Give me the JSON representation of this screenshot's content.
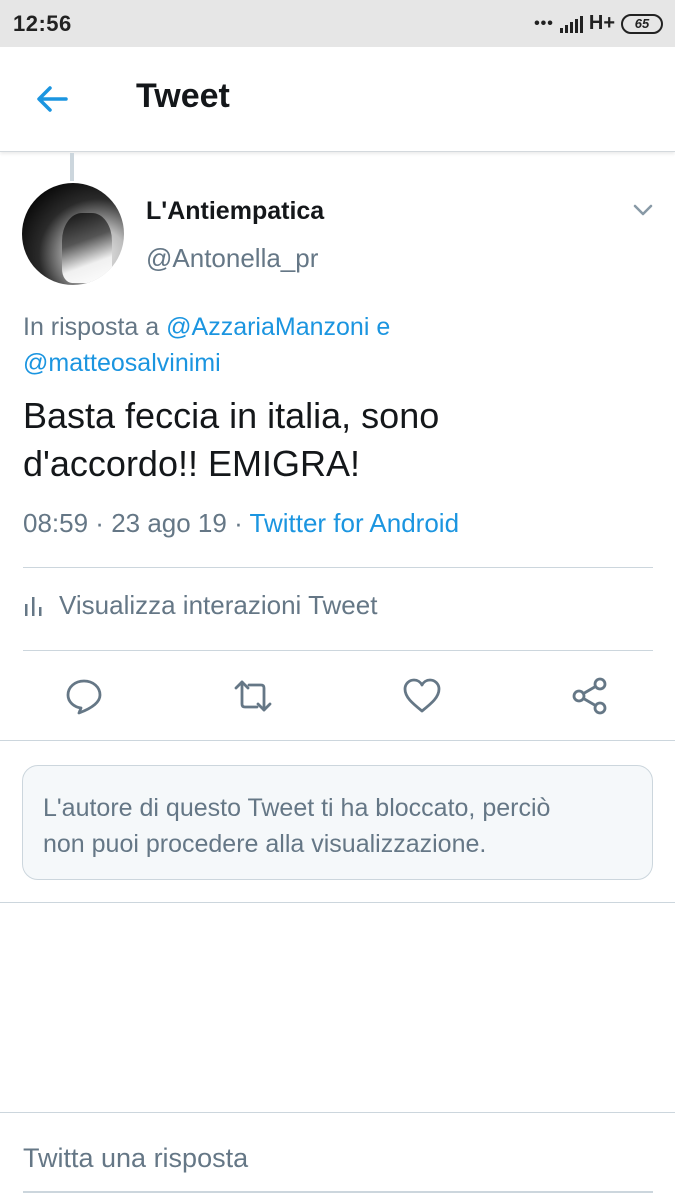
{
  "status_bar": {
    "time": "12:56",
    "dots": "•••",
    "network": "H+",
    "battery": "65"
  },
  "app_bar": {
    "title": "Tweet",
    "back_icon": "arrow-left-icon"
  },
  "tweet": {
    "author": {
      "display_name": "L'Antiempatica",
      "handle": "@Antonella_pr"
    },
    "reply_to": {
      "prefix": "In risposta a ",
      "mention_1": "@AzzariaManzoni",
      "joiner": " e",
      "mention_2": "@matteosalvinimi"
    },
    "text_line_1": "Basta feccia in italia, sono",
    "text_line_2": "d'accordo!! EMIGRA!",
    "time": "08:59",
    "date_sep": " · ",
    "date": "23 ago 19",
    "source_sep": " · ",
    "source": "Twitter for Android",
    "interactions_label": "Visualizza interazioni Tweet"
  },
  "actions": {
    "reply_icon": "comment-icon",
    "retweet_icon": "retweet-icon",
    "like_icon": "heart-icon",
    "share_icon": "share-icon"
  },
  "blocked_notice": {
    "line_1": "L'autore di questo Tweet ti ha bloccato, perciò",
    "line_2": "non puoi procedere alla visualizzazione."
  },
  "reply_box": {
    "placeholder": "Twitta una risposta"
  },
  "colors": {
    "accent": "#1b95e0",
    "secondary_text": "#657786",
    "primary_text": "#14171a",
    "divider": "#ccd6dd"
  }
}
